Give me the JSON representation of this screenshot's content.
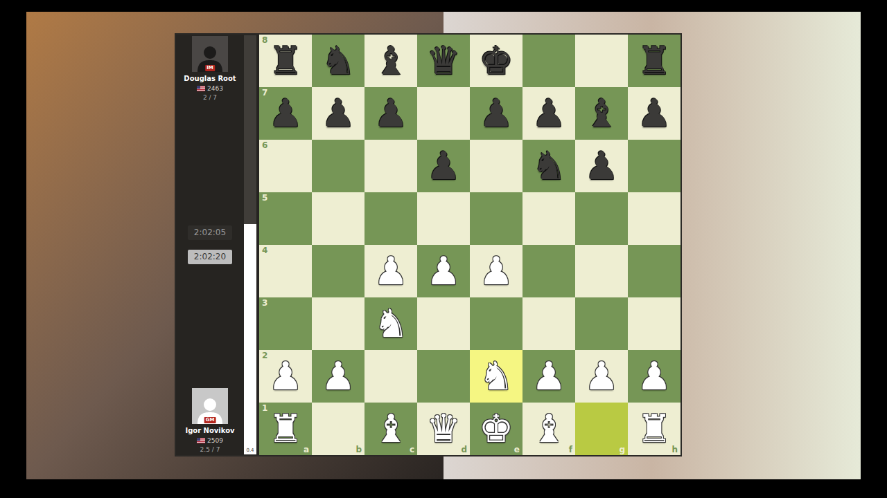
{
  "players": [
    {
      "name": "Douglas Root",
      "title": "IM",
      "rating": "2463",
      "score": "2 / 7",
      "side": "black"
    },
    {
      "name": "Igor Novikov",
      "title": "GM",
      "rating": "2509",
      "score": "2.5 / 7",
      "side": "white"
    }
  ],
  "clocks": [
    {
      "time": "2:02:05",
      "active": false
    },
    {
      "time": "2:02:20",
      "active": true
    }
  ],
  "eval_bar": {
    "level": 0.55,
    "reading": "0.4"
  },
  "board": {
    "files": [
      "a",
      "b",
      "c",
      "d",
      "e",
      "f",
      "g",
      "h"
    ],
    "ranks": [
      {
        "label": "8",
        "squares": [
          {
            "piece": "♜",
            "side": "black",
            "highlight": false
          },
          {
            "piece": "♞",
            "side": "black",
            "highlight": false
          },
          {
            "piece": "♝",
            "side": "black",
            "highlight": false
          },
          {
            "piece": "♛",
            "side": "black",
            "highlight": false
          },
          {
            "piece": "♚",
            "side": "black",
            "highlight": false
          },
          {
            "piece": "",
            "side": "",
            "highlight": false
          },
          {
            "piece": "",
            "side": "",
            "highlight": false
          },
          {
            "piece": "♜",
            "side": "black",
            "highlight": false
          }
        ]
      },
      {
        "label": "7",
        "squares": [
          {
            "piece": "♟",
            "side": "black",
            "highlight": false
          },
          {
            "piece": "♟",
            "side": "black",
            "highlight": false
          },
          {
            "piece": "♟",
            "side": "black",
            "highlight": false
          },
          {
            "piece": "",
            "side": "",
            "highlight": false
          },
          {
            "piece": "♟",
            "side": "black",
            "highlight": false
          },
          {
            "piece": "♟",
            "side": "black",
            "highlight": false
          },
          {
            "piece": "♝",
            "side": "black",
            "highlight": false
          },
          {
            "piece": "♟",
            "side": "black",
            "highlight": false
          }
        ]
      },
      {
        "label": "6",
        "squares": [
          {
            "piece": "",
            "side": "",
            "highlight": false
          },
          {
            "piece": "",
            "side": "",
            "highlight": false
          },
          {
            "piece": "",
            "side": "",
            "highlight": false
          },
          {
            "piece": "♟",
            "side": "black",
            "highlight": false
          },
          {
            "piece": "",
            "side": "",
            "highlight": false
          },
          {
            "piece": "♞",
            "side": "black",
            "highlight": false
          },
          {
            "piece": "♟",
            "side": "black",
            "highlight": false
          },
          {
            "piece": "",
            "side": "",
            "highlight": false
          }
        ]
      },
      {
        "label": "5",
        "squares": [
          {
            "piece": "",
            "side": "",
            "highlight": false
          },
          {
            "piece": "",
            "side": "",
            "highlight": false
          },
          {
            "piece": "",
            "side": "",
            "highlight": false
          },
          {
            "piece": "",
            "side": "",
            "highlight": false
          },
          {
            "piece": "",
            "side": "",
            "highlight": false
          },
          {
            "piece": "",
            "side": "",
            "highlight": false
          },
          {
            "piece": "",
            "side": "",
            "highlight": false
          },
          {
            "piece": "",
            "side": "",
            "highlight": false
          }
        ]
      },
      {
        "label": "4",
        "squares": [
          {
            "piece": "",
            "side": "",
            "highlight": false
          },
          {
            "piece": "",
            "side": "",
            "highlight": false
          },
          {
            "piece": "♟",
            "side": "white",
            "highlight": false
          },
          {
            "piece": "♟",
            "side": "white",
            "highlight": false
          },
          {
            "piece": "♟",
            "side": "white",
            "highlight": false
          },
          {
            "piece": "",
            "side": "",
            "highlight": false
          },
          {
            "piece": "",
            "side": "",
            "highlight": false
          },
          {
            "piece": "",
            "side": "",
            "highlight": false
          }
        ]
      },
      {
        "label": "3",
        "squares": [
          {
            "piece": "",
            "side": "",
            "highlight": false
          },
          {
            "piece": "",
            "side": "",
            "highlight": false
          },
          {
            "piece": "♞",
            "side": "white",
            "highlight": false
          },
          {
            "piece": "",
            "side": "",
            "highlight": false
          },
          {
            "piece": "",
            "side": "",
            "highlight": false
          },
          {
            "piece": "",
            "side": "",
            "highlight": false
          },
          {
            "piece": "",
            "side": "",
            "highlight": false
          },
          {
            "piece": "",
            "side": "",
            "highlight": false
          }
        ]
      },
      {
        "label": "2",
        "squares": [
          {
            "piece": "♟",
            "side": "white",
            "highlight": false
          },
          {
            "piece": "♟",
            "side": "white",
            "highlight": false
          },
          {
            "piece": "",
            "side": "",
            "highlight": false
          },
          {
            "piece": "",
            "side": "",
            "highlight": false
          },
          {
            "piece": "♞",
            "side": "white",
            "highlight": true
          },
          {
            "piece": "♟",
            "side": "white",
            "highlight": false
          },
          {
            "piece": "♟",
            "side": "white",
            "highlight": false
          },
          {
            "piece": "♟",
            "side": "white",
            "highlight": false
          }
        ]
      },
      {
        "label": "1",
        "squares": [
          {
            "piece": "♜",
            "side": "white",
            "highlight": false
          },
          {
            "piece": "",
            "side": "",
            "highlight": false
          },
          {
            "piece": "♝",
            "side": "white",
            "highlight": false
          },
          {
            "piece": "♛",
            "side": "white",
            "highlight": false
          },
          {
            "piece": "♚",
            "side": "white",
            "highlight": false
          },
          {
            "piece": "♝",
            "side": "white",
            "highlight": false
          },
          {
            "piece": "",
            "side": "",
            "highlight": true
          },
          {
            "piece": "♜",
            "side": "white",
            "highlight": false
          }
        ]
      }
    ]
  }
}
